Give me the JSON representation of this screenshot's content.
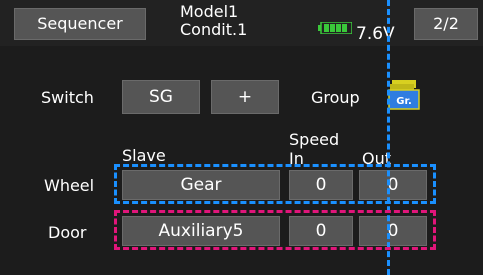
{
  "header": {
    "title": "Sequencer",
    "model_line1": "Model1",
    "model_line2": "Condit.1",
    "voltage": "7.6V",
    "page": "2/2"
  },
  "switch_row": {
    "label": "Switch",
    "value": "SG",
    "mode": "+",
    "group_label": "Group",
    "group_icon_text": "Gr."
  },
  "columns": {
    "slave": "Slave",
    "speed": "Speed",
    "in": "In",
    "out": "Out"
  },
  "rows": [
    {
      "label": "Wheel",
      "slave": "Gear",
      "in": "0",
      "out": "0"
    },
    {
      "label": "Door",
      "slave": "Auxiliary5",
      "in": "0",
      "out": "0"
    }
  ],
  "colors": {
    "highlight_blue": "#1a90ff",
    "highlight_pink": "#e0157a",
    "battery_green": "#3ac93a"
  }
}
